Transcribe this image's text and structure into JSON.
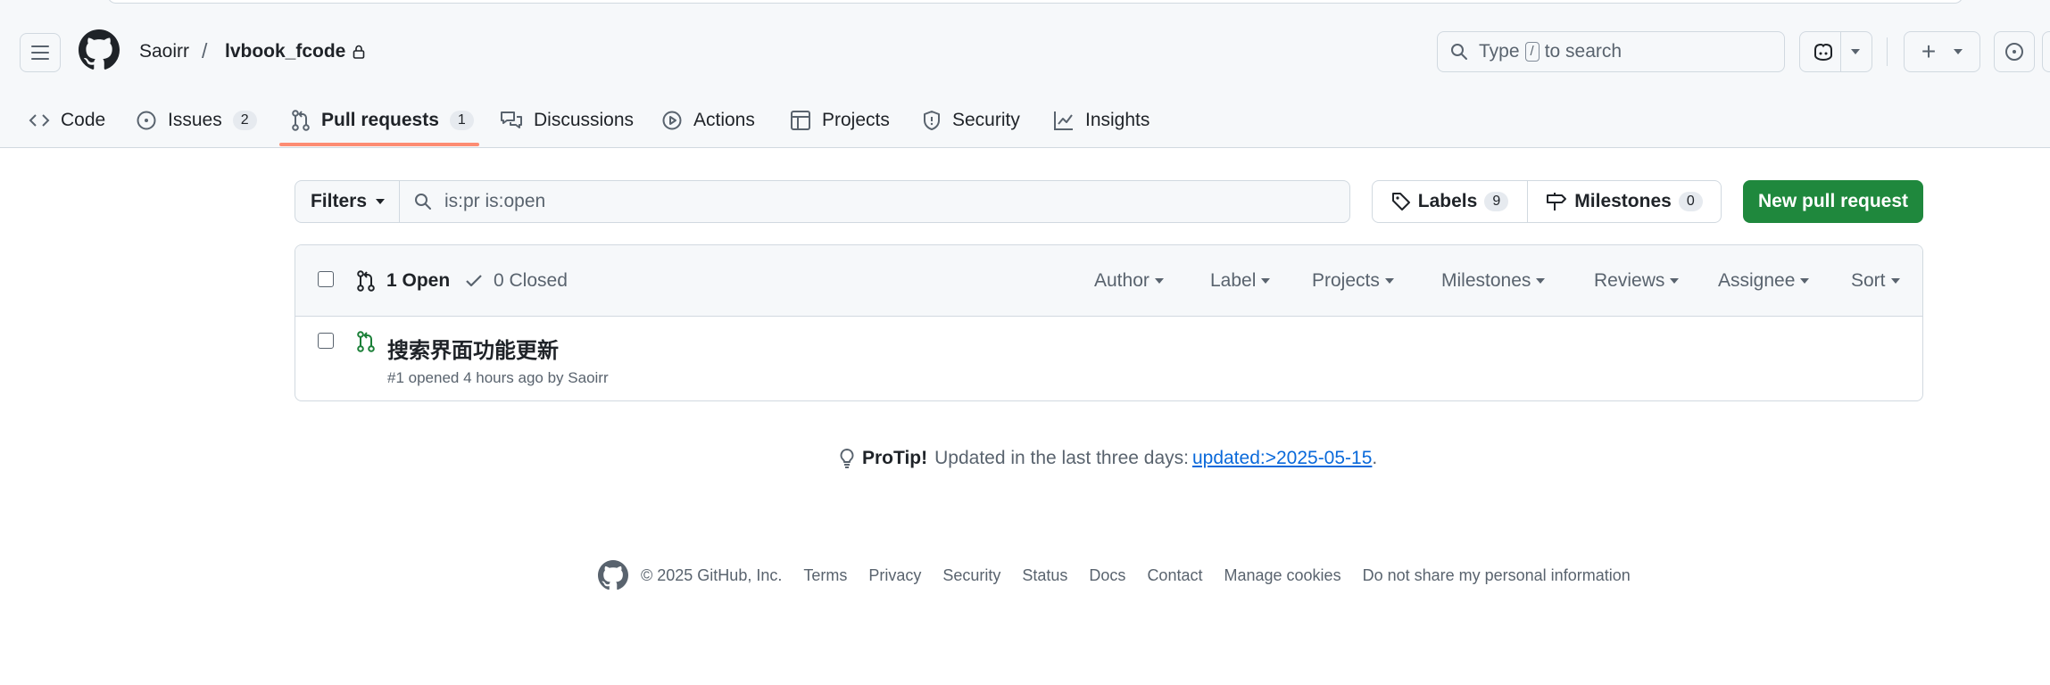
{
  "header": {
    "owner": "Saoirr",
    "separator": "/",
    "repo": "lvbook_fcode",
    "search": {
      "prefix": "Type",
      "key": "/",
      "suffix": "to search"
    }
  },
  "tabs": [
    {
      "label": "Code"
    },
    {
      "label": "Issues",
      "count": "2"
    },
    {
      "label": "Pull requests",
      "count": "1",
      "active": true
    },
    {
      "label": "Discussions"
    },
    {
      "label": "Actions"
    },
    {
      "label": "Projects"
    },
    {
      "label": "Security"
    },
    {
      "label": "Insights"
    }
  ],
  "filterbar": {
    "filters_label": "Filters",
    "query": "is:pr is:open",
    "labels_label": "Labels",
    "labels_count": "9",
    "milestones_label": "Milestones",
    "milestones_count": "0",
    "new_pr_label": "New pull request"
  },
  "list_header": {
    "open": "1 Open",
    "closed": "0 Closed",
    "filters": [
      "Author",
      "Label",
      "Projects",
      "Milestones",
      "Reviews",
      "Assignee",
      "Sort"
    ]
  },
  "pull_requests": [
    {
      "title": "搜索界面功能更新",
      "meta": "#1 opened 4 hours ago by Saoirr"
    }
  ],
  "protip": {
    "label": "ProTip!",
    "text": "Updated in the last three days:",
    "link": "updated:>2025-05-15",
    "end": "."
  },
  "footer": {
    "copyright": "© 2025 GitHub, Inc.",
    "links": [
      "Terms",
      "Privacy",
      "Security",
      "Status",
      "Docs",
      "Contact",
      "Manage cookies",
      "Do not share my personal information"
    ]
  },
  "colors": {
    "accent_green": "#1f883d",
    "tab_underline": "#fd8c73",
    "link_blue": "#0969da",
    "open_icon_green": "#1a7f37"
  }
}
